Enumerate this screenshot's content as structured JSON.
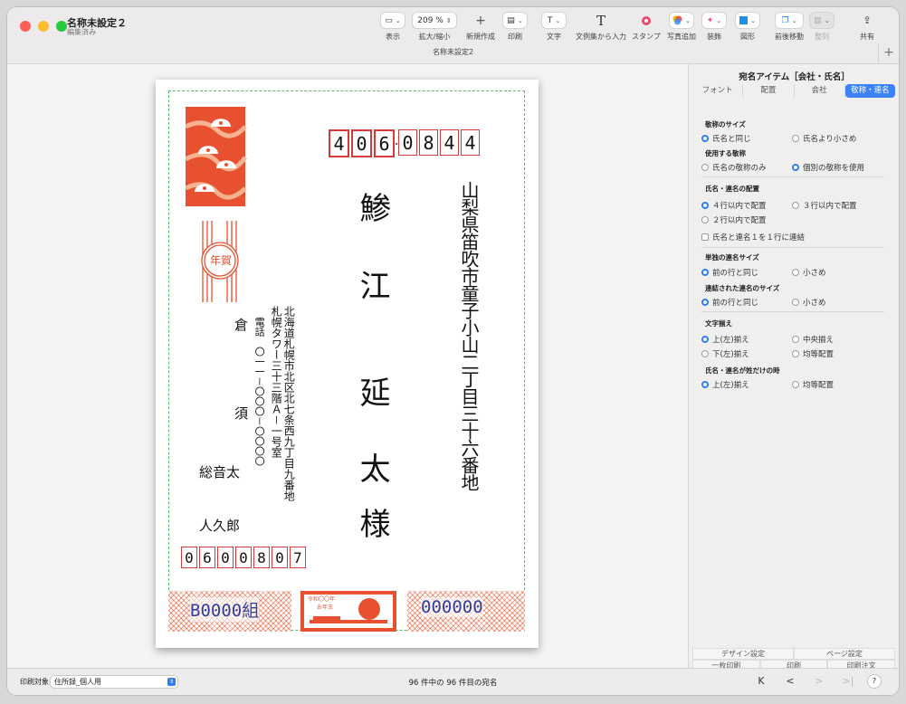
{
  "window": {
    "title": "名称未設定２",
    "subtitle": "編集済み",
    "tab_caption": "名称未設定2",
    "add_tab": "+"
  },
  "toolbar": {
    "view": {
      "label": "表示"
    },
    "zoom": {
      "value": "209 %",
      "label": "拡大/縮小"
    },
    "new": {
      "icon": "+",
      "label": "新規作成"
    },
    "print": {
      "label": "印刷"
    },
    "text": {
      "icon": "T",
      "label": "文字"
    },
    "template": {
      "icon": "T",
      "label": "文例集から入力"
    },
    "stamp": {
      "label": "スタンプ"
    },
    "photo": {
      "label": "写真追加"
    },
    "decor": {
      "label": "装飾"
    },
    "shape": {
      "label": "図形"
    },
    "order": {
      "label": "前後移動"
    },
    "arrange": {
      "label": "整列"
    },
    "share": {
      "label": "共有"
    }
  },
  "postcard": {
    "to_zip": [
      "4",
      "0",
      "6",
      "0",
      "8",
      "4",
      "4"
    ],
    "to_address": "山梨県笛吹市童子小山二丁目三十六番地",
    "to_name_surname_1": "鯵",
    "to_name_surname_2": "江",
    "to_name_given_1": "延",
    "to_name_given_2": "太",
    "honorific": "様",
    "from_address_1": "北海道札幌市北区北七条西九丁目九番地",
    "from_address_2": "札幌タワー三十三階Ａ－一号室",
    "from_phone": "電話　〇一一－〇〇〇－〇〇〇〇",
    "from_surname": "倉　須",
    "from_given_1": "総音太",
    "from_given_2": "人久郎",
    "from_zip": [
      "0",
      "6",
      "0",
      "0",
      "8",
      "0",
      "7"
    ],
    "nenga_label": "年賀",
    "lottery_group": "B0000組",
    "lottery_number": "000000",
    "stamp_text": "令和〇〇年",
    "stamp_subtext": "お年玉"
  },
  "sidebar": {
    "title": "宛名アイテム［会社・氏名］",
    "tabs": [
      "フォント",
      "配置",
      "会社",
      "敬称・連名"
    ],
    "sections": {
      "honor_size": {
        "title": "敬称のサイズ",
        "options": [
          "氏名と同じ",
          "氏名より小さめ"
        ],
        "selected": 0
      },
      "honor_use": {
        "title": "使用する敬称",
        "options": [
          "氏名の敬称のみ",
          "個別の敬称を使用"
        ],
        "selected": 1
      },
      "layout": {
        "title": "氏名・連名の配置",
        "options": [
          "４行以内で配置",
          "３行以内で配置",
          "２行以内で配置"
        ],
        "selected": 0,
        "checkbox": "氏名と連名１を１行に連結"
      },
      "single_size": {
        "title": "単独の連名サイズ",
        "options": [
          "前の行と同じ",
          "小さめ"
        ],
        "selected": 0
      },
      "joined_size": {
        "title": "連結された連名のサイズ",
        "options": [
          "前の行と同じ",
          "小さめ"
        ],
        "selected": 0
      },
      "align": {
        "title": "文字揃え",
        "options": [
          "上(左)揃え",
          "中央揃え",
          "下(左)揃え",
          "均等配置"
        ],
        "selected": 0
      },
      "surname_only": {
        "title": "氏名・連名が姓だけの時",
        "options": [
          "上(左)揃え",
          "均等配置"
        ],
        "selected": 0
      }
    },
    "bottom_row1": [
      "デザイン設定",
      "ページ設定"
    ],
    "bottom_row2": [
      "一枚印刷",
      "印刷",
      "印刷注文"
    ]
  },
  "statusbar": {
    "print_target_label": "印刷対象:",
    "print_target_value": "住所録_個人用",
    "record_status": "96 件中の 96 件目の宛名",
    "nav": [
      "K",
      "<",
      ">",
      ">|"
    ],
    "help": "?"
  },
  "colors": {
    "accent": "#2f7df5",
    "postal_red": "#d53a3a",
    "nenga_red": "#e8512f",
    "lottery_blue": "#2f3f9e",
    "guide_green": "#56b870"
  }
}
